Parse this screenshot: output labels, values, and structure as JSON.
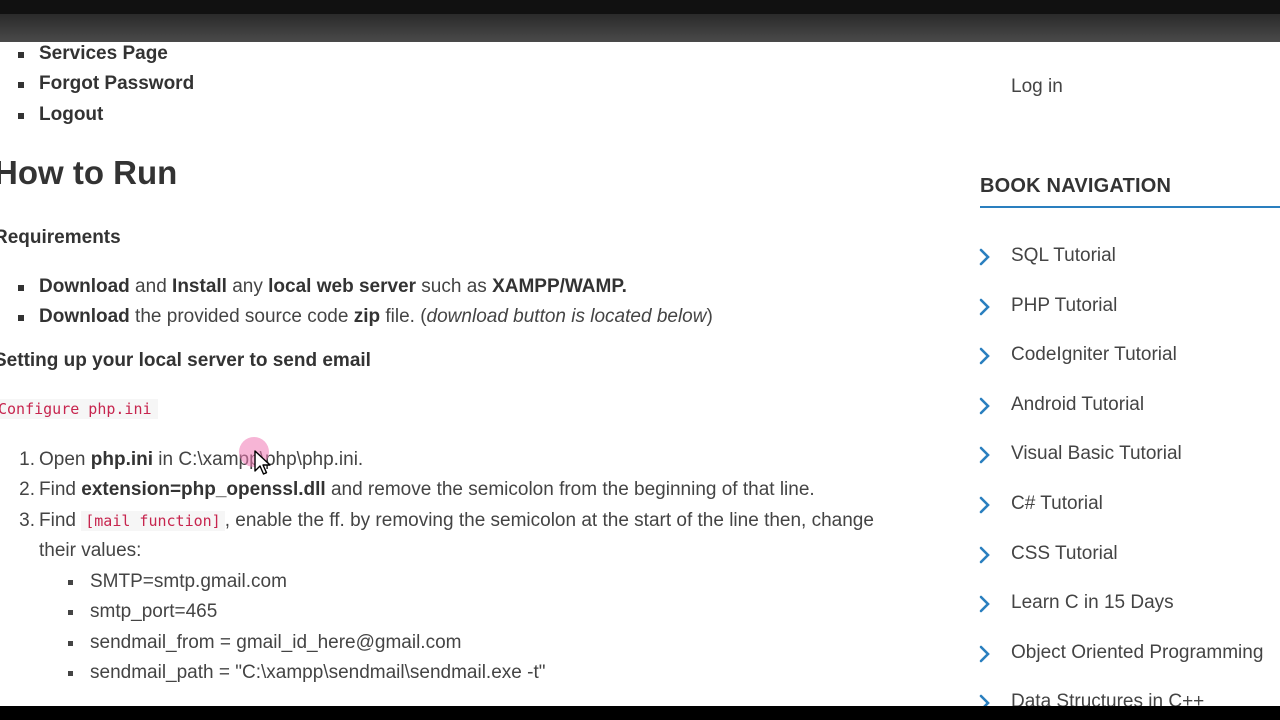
{
  "top_links": [
    "Services Page",
    "Forgot Password",
    "Logout"
  ],
  "heading": "How to Run",
  "requirements_heading": "Requirements",
  "requirements": [
    [
      {
        "t": "Download",
        "b": true
      },
      {
        "t": " and "
      },
      {
        "t": "Install",
        "b": true
      },
      {
        "t": " any "
      },
      {
        "t": "local web server",
        "b": true
      },
      {
        "t": " such as "
      },
      {
        "t": "XAMPP/WAMP.",
        "b": true
      }
    ],
    [
      {
        "t": "Download",
        "b": true
      },
      {
        "t": " the provided source code "
      },
      {
        "t": "zip",
        "b": true
      },
      {
        "t": " file. ("
      },
      {
        "t": "download button is located below",
        "i": true
      },
      {
        "t": ")"
      }
    ]
  ],
  "setup_heading": "Setting up your local server to send email",
  "config_code": "Configure php.ini",
  "steps": [
    [
      {
        "t": "Open "
      },
      {
        "t": "php.ini",
        "b": true
      },
      {
        "t": " in C:\\xampp\\php\\php.ini."
      }
    ],
    [
      {
        "t": "Find "
      },
      {
        "t": "extension=php_openssl.dll",
        "b": true
      },
      {
        "t": " and remove the semicolon from the beginning of that line."
      }
    ],
    [
      {
        "t": "Find "
      },
      {
        "t": "[mail function]",
        "code": true
      },
      {
        "t": ", enable the ff. by removing the semicolon at the start of the line then, change"
      }
    ]
  ],
  "step3_continuation": "their values:",
  "settings": [
    "SMTP=smtp.gmail.com",
    "smtp_port=465",
    "sendmail_from = gmail_id_here@gmail.com",
    "sendmail_path = \"C:\\xampp\\sendmail\\sendmail.exe -t\""
  ],
  "sidebar": {
    "login": "Log in",
    "book_title": "BOOK NAVIGATION",
    "items": [
      "SQL Tutorial",
      "PHP Tutorial",
      "CodeIgniter Tutorial",
      "Android Tutorial",
      "Visual Basic Tutorial",
      "C# Tutorial",
      "CSS Tutorial",
      "Learn C in 15 Days",
      "Object Oriented Programming",
      "Data Structures in C++"
    ]
  },
  "colors": {
    "accent": "#2a7fbf",
    "code": "#c7254e",
    "chevron": "#2a7fbf"
  }
}
